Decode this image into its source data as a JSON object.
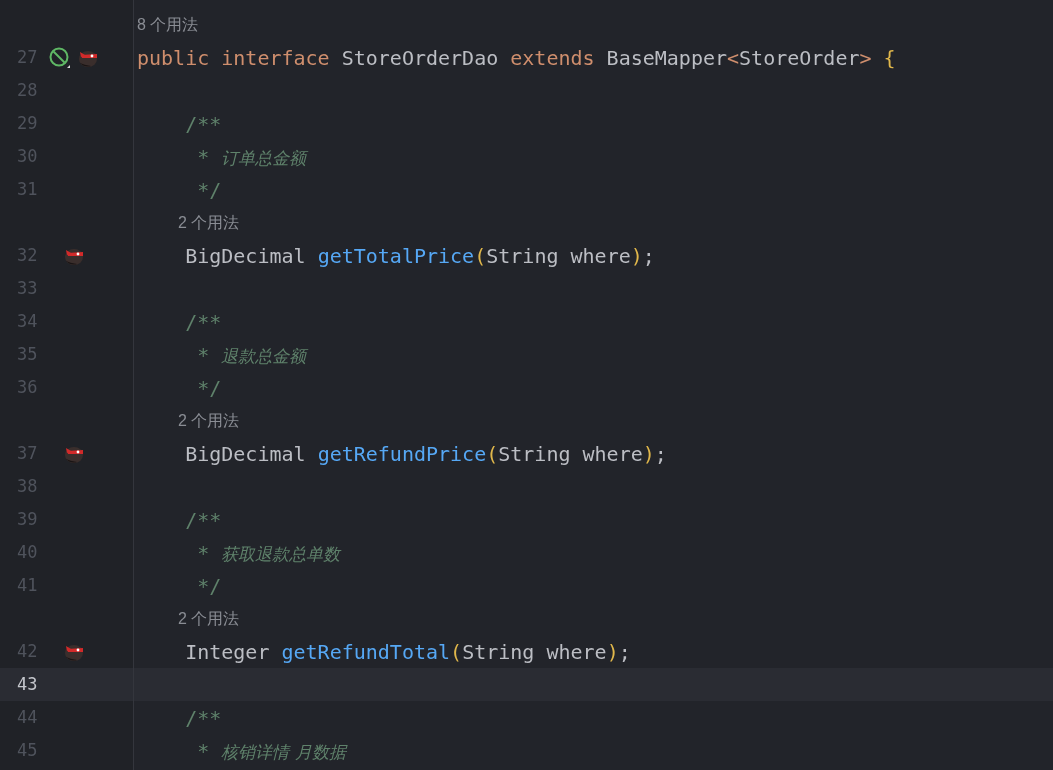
{
  "editor": {
    "rows": [
      {
        "kind": "hint",
        "text": "8 个用法"
      },
      {
        "kind": "code",
        "number": "27",
        "current": false,
        "markers": [
          {
            "kind": "blocked"
          },
          {
            "kind": "bird"
          }
        ],
        "tokens": [
          {
            "kind": "keyword",
            "text": "public interface"
          },
          {
            "kind": "plain",
            "text": " StoreOrderDao "
          },
          {
            "kind": "keyword",
            "text": "extends"
          },
          {
            "kind": "plain",
            "text": " BaseMapper"
          },
          {
            "kind": "keyword",
            "text": "<"
          },
          {
            "kind": "plain",
            "text": "StoreOrder"
          },
          {
            "kind": "keyword",
            "text": ">"
          },
          {
            "kind": "brace",
            "text": " {"
          }
        ]
      },
      {
        "kind": "code",
        "number": "28",
        "current": false
      },
      {
        "kind": "code",
        "number": "29",
        "current": false,
        "tokens": [
          {
            "kind": "doc",
            "text": "    /**"
          }
        ]
      },
      {
        "kind": "code",
        "number": "30",
        "current": false,
        "tokens": [
          {
            "kind": "doc",
            "text": "     * "
          },
          {
            "kind": "doctext",
            "text": "订单总金额"
          }
        ]
      },
      {
        "kind": "code",
        "number": "31",
        "current": false,
        "tokens": [
          {
            "kind": "doc",
            "text": "     */"
          }
        ]
      },
      {
        "kind": "hint",
        "text": "2 个用法"
      },
      {
        "kind": "code",
        "number": "32",
        "current": false,
        "markers": [
          {
            "kind": "bird"
          }
        ],
        "tokens": [
          {
            "kind": "plain",
            "text": "    BigDecimal "
          },
          {
            "kind": "method",
            "text": "getTotalPrice"
          },
          {
            "kind": "brace",
            "text": "("
          },
          {
            "kind": "plain",
            "text": "String where"
          },
          {
            "kind": "brace",
            "text": ")"
          },
          {
            "kind": "plain",
            "text": ";"
          }
        ]
      },
      {
        "kind": "code",
        "number": "33",
        "current": false
      },
      {
        "kind": "code",
        "number": "34",
        "current": false,
        "tokens": [
          {
            "kind": "doc",
            "text": "    /**"
          }
        ]
      },
      {
        "kind": "code",
        "number": "35",
        "current": false,
        "tokens": [
          {
            "kind": "doc",
            "text": "     * "
          },
          {
            "kind": "doctext",
            "text": "退款总金额"
          }
        ]
      },
      {
        "kind": "code",
        "number": "36",
        "current": false,
        "tokens": [
          {
            "kind": "doc",
            "text": "     */"
          }
        ]
      },
      {
        "kind": "hint",
        "text": "2 个用法"
      },
      {
        "kind": "code",
        "number": "37",
        "current": false,
        "markers": [
          {
            "kind": "bird"
          }
        ],
        "tokens": [
          {
            "kind": "plain",
            "text": "    BigDecimal "
          },
          {
            "kind": "method",
            "text": "getRefundPrice"
          },
          {
            "kind": "brace",
            "text": "("
          },
          {
            "kind": "plain",
            "text": "String where"
          },
          {
            "kind": "brace",
            "text": ")"
          },
          {
            "kind": "plain",
            "text": ";"
          }
        ]
      },
      {
        "kind": "code",
        "number": "38",
        "current": false
      },
      {
        "kind": "code",
        "number": "39",
        "current": false,
        "tokens": [
          {
            "kind": "doc",
            "text": "    /**"
          }
        ]
      },
      {
        "kind": "code",
        "number": "40",
        "current": false,
        "tokens": [
          {
            "kind": "doc",
            "text": "     * "
          },
          {
            "kind": "doctext",
            "text": "获取退款总单数"
          }
        ]
      },
      {
        "kind": "code",
        "number": "41",
        "current": false,
        "tokens": [
          {
            "kind": "doc",
            "text": "     */"
          }
        ]
      },
      {
        "kind": "hint",
        "text": "2 个用法"
      },
      {
        "kind": "code",
        "number": "42",
        "current": false,
        "markers": [
          {
            "kind": "bird"
          }
        ],
        "tokens": [
          {
            "kind": "plain",
            "text": "    Integer "
          },
          {
            "kind": "method",
            "text": "getRefundTotal"
          },
          {
            "kind": "brace",
            "text": "("
          },
          {
            "kind": "plain",
            "text": "String where"
          },
          {
            "kind": "brace",
            "text": ")"
          },
          {
            "kind": "plain",
            "text": ";"
          }
        ]
      },
      {
        "kind": "code",
        "number": "43",
        "current": true
      },
      {
        "kind": "code",
        "number": "44",
        "current": false,
        "tokens": [
          {
            "kind": "doc",
            "text": "    /**"
          }
        ]
      },
      {
        "kind": "code",
        "number": "45",
        "current": false,
        "tokens": [
          {
            "kind": "doc",
            "text": "     * "
          },
          {
            "kind": "doctext",
            "text": "核销详情 月数据"
          }
        ]
      }
    ]
  }
}
